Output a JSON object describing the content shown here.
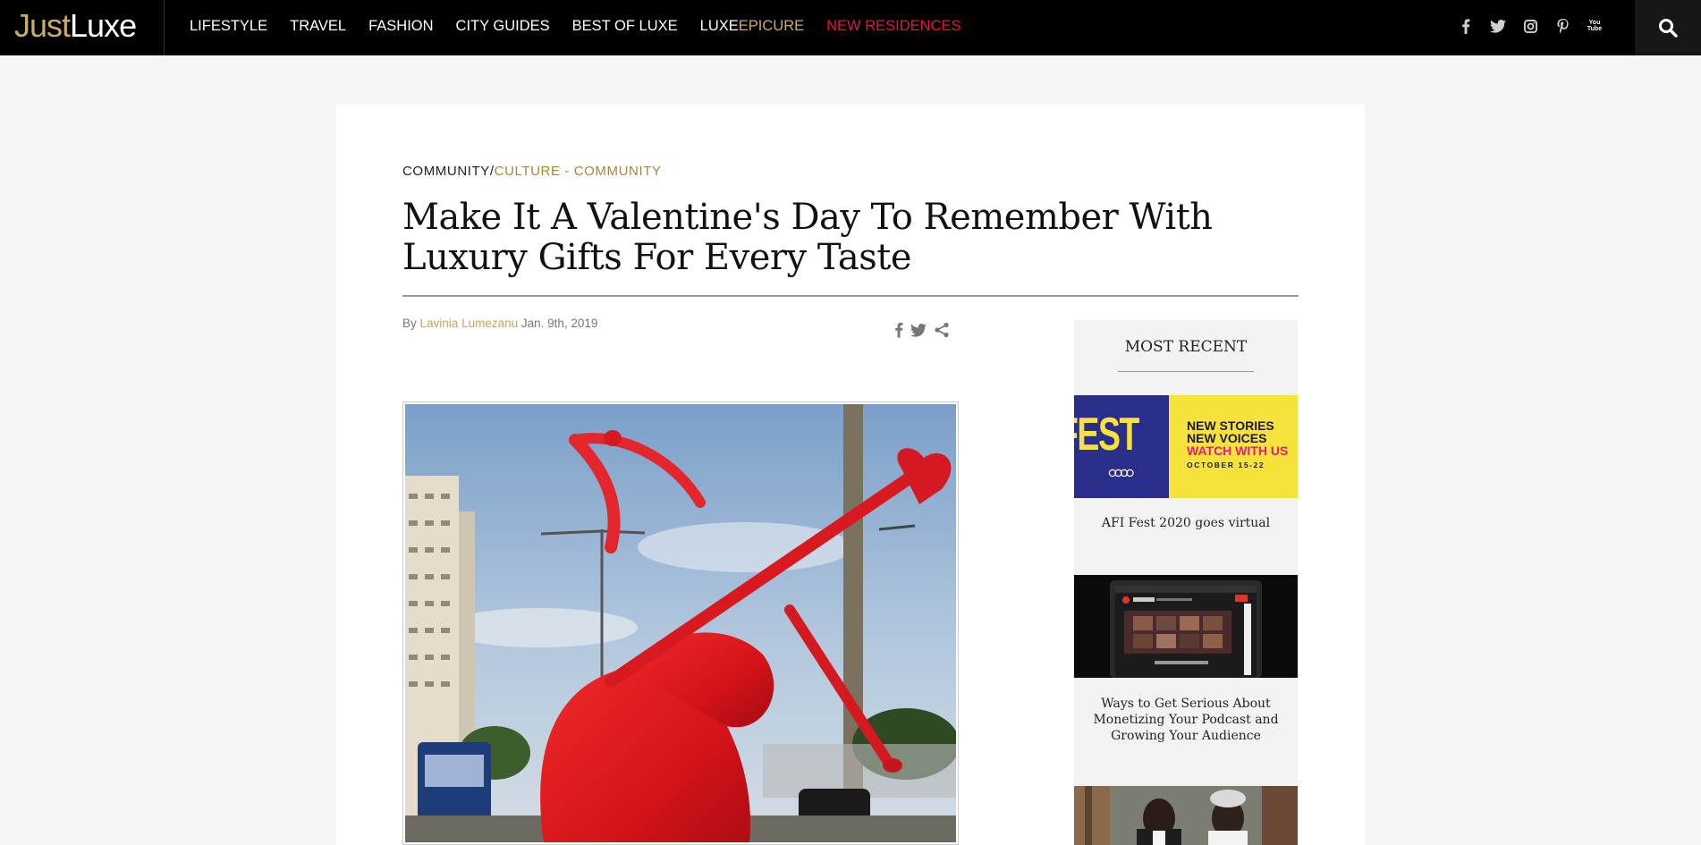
{
  "header": {
    "logo_just": "Just",
    "logo_luxe": "Luxe",
    "nav": {
      "lifestyle": "LIFESTYLE",
      "travel": "TRAVEL",
      "fashion": "FASHION",
      "city_guides": "CITY GUIDES",
      "best_of_luxe": "BEST OF LUXE",
      "luxeepicure_a": "LUXE",
      "luxeepicure_b": "EPICURE",
      "new_residences": "NEW RESIDENCES"
    },
    "social_icons": [
      "facebook-icon",
      "twitter-icon",
      "instagram-icon",
      "pinterest-icon",
      "youtube-icon"
    ],
    "youtube_top": "You",
    "youtube_bottom": "Tube",
    "colors": {
      "brand_gold": "#c9ab6a",
      "accent_red": "#e3173e",
      "bar": "#000000"
    }
  },
  "article": {
    "breadcrumb_primary": "COMMUNITY",
    "breadcrumb_sep": "/",
    "breadcrumb_secondary": "CULTURE - COMMUNITY",
    "title": "Make It A Valentine's Day To Remember With Luxury Gifts For Every Taste",
    "by_label": "By",
    "author": "Lavinia Lumezanu",
    "date": "Jan. 9th, 2019",
    "share_icons": [
      "facebook-icon",
      "twitter-icon",
      "share-icon"
    ]
  },
  "sidebar": {
    "title": "MOST RECENT",
    "items": [
      {
        "caption": "AFI Fest 2020 goes virtual",
        "image_text_fest": "FEST",
        "image_text_line1": "NEW STORIES",
        "image_text_line2": "NEW VOICES",
        "image_text_line3": "WATCH WITH US",
        "image_text_line4": "OCTOBER 15-22"
      },
      {
        "caption": "Ways to Get Serious About Monetizing Your Podcast and Growing Your Audience"
      }
    ]
  }
}
